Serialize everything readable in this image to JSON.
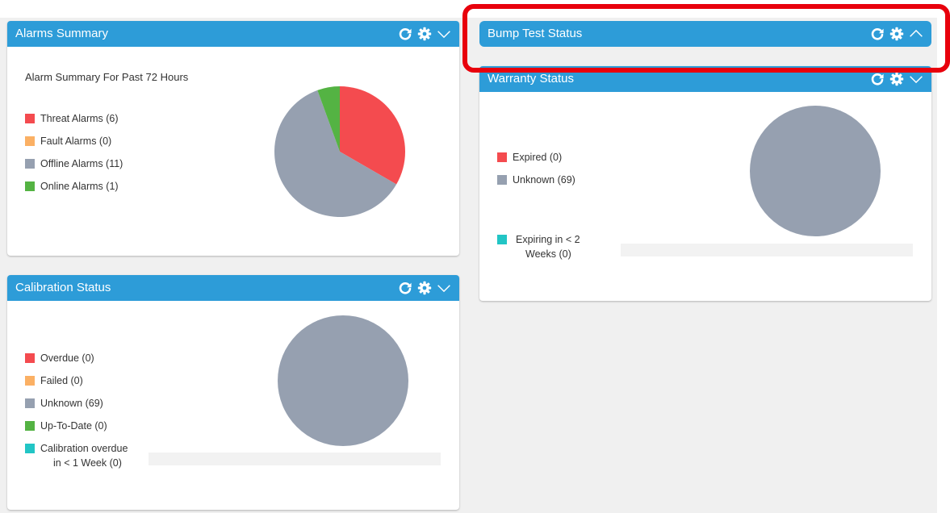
{
  "colors": {
    "header": "#2d9cd8",
    "threat": "#f44b4f",
    "fault": "#fbb064",
    "offline": "#96a0b0",
    "online": "#54b343",
    "teal": "#22c5c5"
  },
  "icons": {
    "refresh": "refresh-icon",
    "settings": "gear-icon",
    "collapse": "chevron-down-icon",
    "expand": "chevron-up-icon"
  },
  "alarms": {
    "title": "Alarms Summary",
    "subtitle": "Alarm Summary For Past 72 Hours",
    "legend": [
      {
        "label": "Threat Alarms (6)",
        "color": "#f44b4f"
      },
      {
        "label": "Fault Alarms (0)",
        "color": "#fbb064"
      },
      {
        "label": "Offline Alarms (11)",
        "color": "#96a0b0"
      },
      {
        "label": "Online Alarms (1)",
        "color": "#54b343"
      }
    ],
    "chart_data": {
      "type": "pie",
      "categories": [
        "Threat Alarms",
        "Fault Alarms",
        "Offline Alarms",
        "Online Alarms"
      ],
      "values": [
        6,
        0,
        11,
        1
      ]
    }
  },
  "calibration": {
    "title": "Calibration Status",
    "legend": [
      {
        "label": "Overdue (0)",
        "color": "#f44b4f"
      },
      {
        "label": "Failed (0)",
        "color": "#fbb064"
      },
      {
        "label": "Unknown (69)",
        "color": "#96a0b0"
      },
      {
        "label": "Up-To-Date (0)",
        "color": "#54b343"
      },
      {
        "label": "Calibration overdue",
        "color": "#22c5c5",
        "label2": "in < 1 Week (0)"
      }
    ],
    "chart_data": {
      "type": "pie",
      "categories": [
        "Overdue",
        "Failed",
        "Unknown",
        "Up-To-Date",
        "Calibration overdue in < 1 Week"
      ],
      "values": [
        0,
        0,
        69,
        0,
        0
      ]
    }
  },
  "bump": {
    "title": "Bump Test Status"
  },
  "warranty": {
    "title": "Warranty Status",
    "legend": [
      {
        "label": "Expired (0)",
        "color": "#f44b4f"
      },
      {
        "label": "Unknown (69)",
        "color": "#96a0b0"
      }
    ],
    "legend_bottom": {
      "label": "Expiring in < 2",
      "label2": "Weeks (0)",
      "color": "#22c5c5"
    },
    "chart_data": {
      "type": "pie",
      "categories": [
        "Expired",
        "Unknown",
        "Expiring in < 2 Weeks"
      ],
      "values": [
        0,
        69,
        0
      ]
    }
  }
}
